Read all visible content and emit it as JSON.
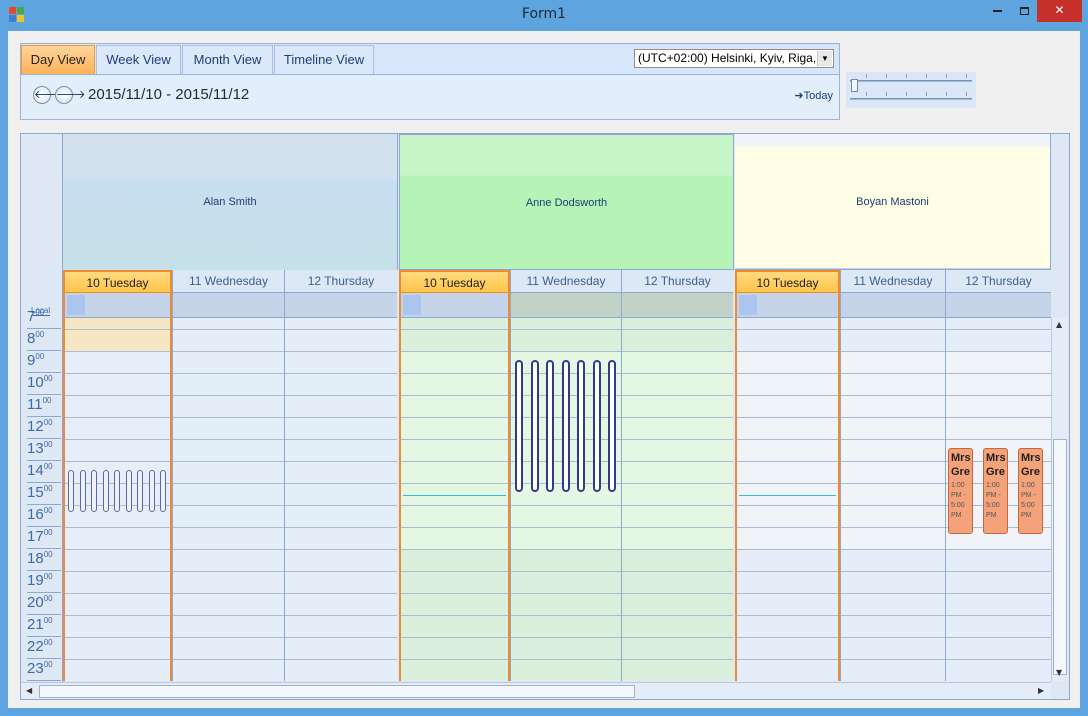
{
  "window": {
    "title": "Form1",
    "min_label": "▀",
    "max_label": "□",
    "close_label": "✕"
  },
  "tabs": [
    "Day View",
    "Week View",
    "Month View",
    "Timeline View"
  ],
  "timezone": {
    "value": "(UTC+02:00) Helsinki, Kyiv, Riga,"
  },
  "navigation": {
    "date_range": "2015/11/10 - 2015/11/12",
    "today_label": "Today",
    "prev_icon": "arrow-left-icon",
    "next_icon": "arrow-right-icon"
  },
  "scheduler": {
    "local_label": "Local",
    "resources": [
      {
        "name": "Alan Smith",
        "color": "#cfe0ee"
      },
      {
        "name": "Anne Dodsworth",
        "color": "#b6f3b6"
      },
      {
        "name": "Boyan Mastoni",
        "color": "#fffde6"
      }
    ],
    "days": [
      "10 Tuesday",
      "11 Wednesday",
      "12 Thursday"
    ],
    "hours": [
      {
        "h": "7",
        "m": "00"
      },
      {
        "h": "8",
        "m": "00"
      },
      {
        "h": "9",
        "m": "00"
      },
      {
        "h": "10",
        "m": "00"
      },
      {
        "h": "11",
        "m": "00"
      },
      {
        "h": "12",
        "m": "00"
      },
      {
        "h": "13",
        "m": "00"
      },
      {
        "h": "14",
        "m": "00"
      },
      {
        "h": "15",
        "m": "00"
      },
      {
        "h": "16",
        "m": "00"
      },
      {
        "h": "17",
        "m": "00"
      },
      {
        "h": "18",
        "m": "00"
      },
      {
        "h": "19",
        "m": "00"
      },
      {
        "h": "20",
        "m": "00"
      },
      {
        "h": "21",
        "m": "00"
      },
      {
        "h": "22",
        "m": "00"
      },
      {
        "h": "23",
        "m": "00"
      }
    ],
    "appointments": [
      {
        "subject_line1": "Mrs",
        "subject_line2": "Gre",
        "time": "1:00 PM - 5:00 PM"
      },
      {
        "subject_line1": "Mrs",
        "subject_line2": "Gre",
        "time": "1:00 PM - 5:00 PM"
      },
      {
        "subject_line1": "Mrs",
        "subject_line2": "Gre",
        "time": "1:00 PM - 5:00 PM"
      }
    ],
    "accent_today": "#ef8a33"
  }
}
